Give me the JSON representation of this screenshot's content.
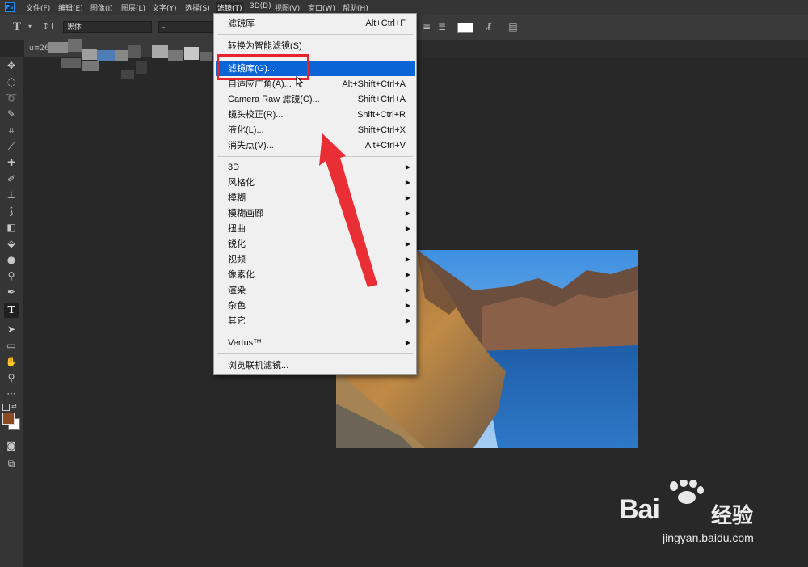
{
  "menubar": {
    "items": [
      "文件(F)",
      "编辑(E)",
      "图像(I)",
      "图层(L)",
      "文字(Y)",
      "选择(S)",
      "滤镜(T)",
      "3D(D)",
      "视图(V)",
      "窗口(W)",
      "帮助(H)"
    ]
  },
  "options": {
    "font_family": "黑体",
    "font_style": "-"
  },
  "document_tab": {
    "label": "u≡26."
  },
  "filter_menu": {
    "last_filter": {
      "label": "滤镜库",
      "shortcut": "Alt+Ctrl+F"
    },
    "convert_smart": {
      "label": "转换为智能滤镜(S)"
    },
    "items": [
      {
        "label": "滤镜库(G)...",
        "shortcut": ""
      },
      {
        "label": "自适应广角(A)...",
        "shortcut": "Alt+Shift+Ctrl+A"
      },
      {
        "label": "Camera Raw 滤镜(C)...",
        "shortcut": "Shift+Ctrl+A"
      },
      {
        "label": "镜头校正(R)...",
        "shortcut": "Shift+Ctrl+R"
      },
      {
        "label": "液化(L)...",
        "shortcut": "Shift+Ctrl+X"
      },
      {
        "label": "消失点(V)...",
        "shortcut": "Alt+Ctrl+V"
      }
    ],
    "submenus": [
      "3D",
      "风格化",
      "模糊",
      "模糊画廊",
      "扭曲",
      "锐化",
      "视频",
      "像素化",
      "渲染",
      "杂色",
      "其它"
    ],
    "vertus": "Vertus™",
    "browse": "浏览联机滤镜..."
  },
  "colors": {
    "foreground": "#8b4a22",
    "background": "#ffffff",
    "highlight": "#0a64d6",
    "annotation": "#e8232b"
  },
  "watermark": {
    "brand": "Bai",
    "brand_suffix": "经验",
    "url": "jingyan.baidu.com"
  }
}
